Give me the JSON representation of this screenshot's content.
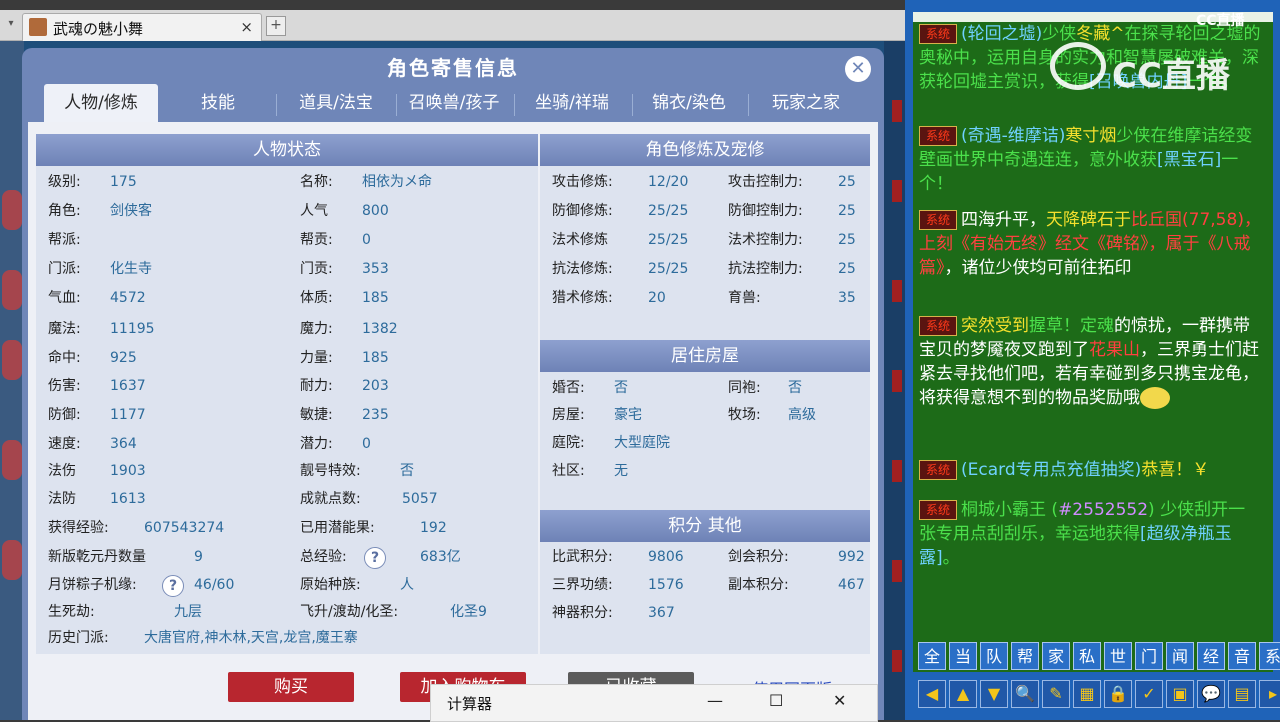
{
  "browser": {
    "tab_title": "武魂の魅小舞",
    "tab_close": "×",
    "new_tab": "+",
    "window_controls": "—☐✕"
  },
  "dialog": {
    "title": "角色寄售信息",
    "close": "✕",
    "tabs": [
      "人物/修炼",
      "技能",
      "道具/法宝",
      "召唤兽/孩子",
      "坐骑/祥瑞",
      "锦衣/染色",
      "玩家之家"
    ],
    "left_header": "人物状态",
    "stats_left": [
      {
        "k": "级别:",
        "v": "175"
      },
      {
        "k": "角色:",
        "v": "剑侠客"
      },
      {
        "k": "帮派:",
        "v": ""
      },
      {
        "k": "门派:",
        "v": "化生寺"
      },
      {
        "k": "气血:",
        "v": "4572"
      },
      {
        "k": "魔法:",
        "v": "11195"
      },
      {
        "k": "命中:",
        "v": "925"
      },
      {
        "k": "伤害:",
        "v": "1637"
      },
      {
        "k": "防御:",
        "v": "1177"
      },
      {
        "k": "速度:",
        "v": "364"
      },
      {
        "k": "法伤",
        "v": "1903"
      },
      {
        "k": "法防",
        "v": "1613"
      },
      {
        "k": "获得经验:",
        "v": "607543274"
      },
      {
        "k": "新版乾元丹数量",
        "v": "9"
      },
      {
        "k": "月饼粽子机缘:",
        "v": "46/60"
      },
      {
        "k": "生死劫:",
        "v": "九层"
      },
      {
        "k": "历史门派:",
        "v": "大唐官府,神木林,天宫,龙宫,魔王寨"
      }
    ],
    "stats_mid": [
      {
        "k": "名称:",
        "v": "相依为メ命"
      },
      {
        "k": "人气",
        "v": "800"
      },
      {
        "k": "帮贡:",
        "v": "0"
      },
      {
        "k": "门贡:",
        "v": "353"
      },
      {
        "k": "体质:",
        "v": "185"
      },
      {
        "k": "魔力:",
        "v": "1382"
      },
      {
        "k": "力量:",
        "v": "185"
      },
      {
        "k": "耐力:",
        "v": "203"
      },
      {
        "k": "敏捷:",
        "v": "235"
      },
      {
        "k": "潜力:",
        "v": "0"
      },
      {
        "k": "靓号特效:",
        "v": "否"
      },
      {
        "k": "成就点数:",
        "v": "5057"
      },
      {
        "k": "已用潜能果:",
        "v": "192"
      },
      {
        "k": "总经验:",
        "v": "683亿"
      },
      {
        "k": "原始种族:",
        "v": "人"
      },
      {
        "k": "飞升/渡劫/化圣:",
        "v": "化圣9"
      }
    ],
    "help_mark": "?",
    "cultivation_header": "角色修炼及宠修",
    "cultivation": [
      {
        "k1": "攻击修炼:",
        "v1": "12/20",
        "k2": "攻击控制力:",
        "v2": "25"
      },
      {
        "k1": "防御修炼:",
        "v1": "25/25",
        "k2": "防御控制力:",
        "v2": "25"
      },
      {
        "k1": "法术修炼",
        "v1": "25/25",
        "k2": "法术控制力:",
        "v2": "25"
      },
      {
        "k1": "抗法修炼:",
        "v1": "25/25",
        "k2": "抗法控制力:",
        "v2": "25"
      },
      {
        "k1": "猎术修炼:",
        "v1": "20",
        "k2": "育兽:",
        "v2": "35"
      }
    ],
    "house_header": "居住房屋",
    "house": [
      {
        "k1": "婚否:",
        "v1": "否",
        "k2": "同袍:",
        "v2": "否"
      },
      {
        "k1": "房屋:",
        "v1": "豪宅",
        "k2": "牧场:",
        "v2": "高级"
      },
      {
        "k1": "庭院:",
        "v1": "大型庭院",
        "k2": "",
        "v2": ""
      },
      {
        "k1": "社区:",
        "v1": "无",
        "k2": "",
        "v2": ""
      }
    ],
    "score_header": "积分 其他",
    "scores": [
      {
        "k1": "比武积分:",
        "v1": "9806",
        "k2": "剑会积分:",
        "v2": "992"
      },
      {
        "k1": "三界功绩:",
        "v1": "1576",
        "k2": "副本积分:",
        "v2": "467"
      },
      {
        "k1": "神器积分:",
        "v1": "367",
        "k2": "",
        "v2": ""
      }
    ],
    "buttons": {
      "buy": "购买",
      "cart": "加入购物车",
      "collected": "已收藏",
      "link": "使用网页版"
    }
  },
  "calculator": {
    "title": "计算器",
    "minimize": "—",
    "maximize": "☐",
    "close": "✕"
  },
  "chat": {
    "corner_logo": "CC直播",
    "watermark": "CC直播",
    "sys_tag": "系统",
    "messages": [
      {
        "parts": [
          [
            "c",
            "(轮回之墟)"
          ],
          [
            "g",
            "少侠"
          ],
          [
            "y",
            "冬藏^"
          ],
          [
            "g",
            "在探寻轮回之墟的奥秘中，运用自身的实力和智慧屡破难关，深获轮回墟主赏识，获得"
          ],
          [
            "c",
            "[召唤兽内丹]"
          ],
          [
            "g",
            "一个。"
          ]
        ]
      },
      {
        "parts": [
          [
            "c",
            "(奇遇-维摩诘)"
          ],
          [
            "y",
            "寒寸烟"
          ],
          [
            "g",
            "少侠在维摩诘经变壁画世界中奇遇连连，意外收获"
          ],
          [
            "c",
            "[黑宝石]"
          ],
          [
            "g",
            "一个！"
          ]
        ]
      },
      {
        "parts": [
          [
            "w",
            "四海升平，"
          ],
          [
            "y",
            "天降碑石于"
          ],
          [
            "r",
            "比丘国(77,58)，上刻《有始无终》经文《碑铭》，属于《八戒篇》"
          ],
          [
            "w",
            "，诸位少侠均可前往拓印"
          ]
        ]
      },
      {
        "parts": [
          [
            "y",
            "突然受到"
          ],
          [
            "g",
            "握草！定魂"
          ],
          [
            "w",
            "的惊扰，一群携带宝贝的梦魇夜叉跑到了"
          ],
          [
            "r",
            "花果山"
          ],
          [
            "w",
            "，三界勇士们赶紧去寻找他们吧，若有幸碰到多只携宝龙龟，将获得意想不到的物品奖励哦"
          ]
        ]
      },
      {
        "parts": [
          [
            "c",
            "(Ecard专用点充值抽奖)"
          ],
          [
            "y",
            "恭喜！￥"
          ]
        ]
      },
      {
        "parts": [
          [
            "g",
            "桐城小霸王 ("
          ],
          [
            "p",
            "#2552552"
          ],
          [
            "g",
            ") 少侠刮开一张专用点刮刮乐，幸运地获得"
          ],
          [
            "c",
            "[超级净瓶玉露]"
          ],
          [
            "g",
            "。"
          ]
        ]
      }
    ],
    "channels": [
      "全",
      "当",
      "队",
      "帮",
      "家",
      "私",
      "世",
      "门",
      "闻",
      "经",
      "音",
      "系"
    ],
    "tools": [
      "◀",
      "▲",
      "▼",
      "🔍",
      "✎",
      "▦",
      "🔒",
      "✓",
      "▣",
      "💬",
      "▤",
      "▸"
    ]
  }
}
